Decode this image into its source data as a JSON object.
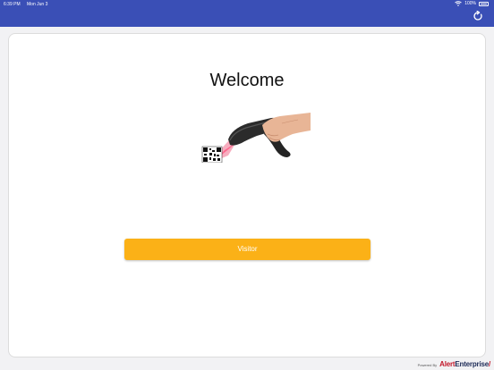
{
  "status_bar": {
    "time": "6:39 PM",
    "date": "Mon Jun 3",
    "battery": "100%"
  },
  "header": {
    "background_color": "#3a4fb6",
    "refresh_icon": "refresh-icon"
  },
  "main": {
    "title": "Welcome",
    "image_icon": "barcode-scanner-illustration",
    "visitor_button_label": "Visitor",
    "visitor_button_color": "#fbb117"
  },
  "footer": {
    "powered_by": "Powered By",
    "brand_part1": "Alert",
    "brand_part2": "Enterprise",
    "brand_mark": "/"
  }
}
